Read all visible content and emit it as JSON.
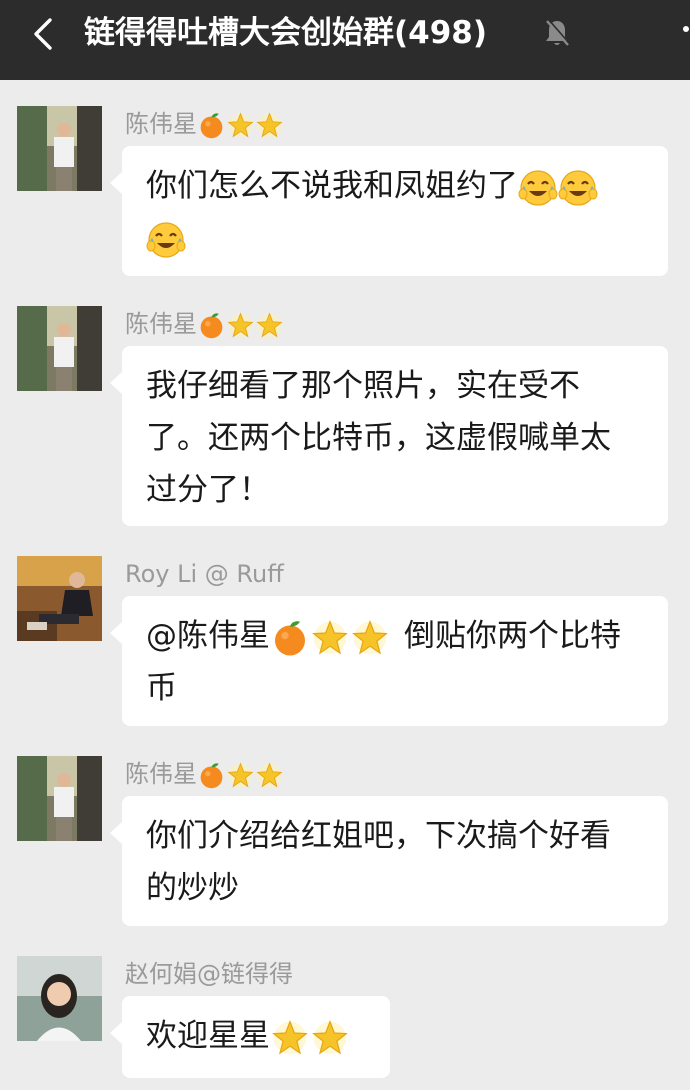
{
  "header": {
    "title": "链得得吐槽大会创始群(498)",
    "back_icon": "chevron-left-icon",
    "mute_icon": "bell-muted-icon",
    "more_icon": "more-icon"
  },
  "colors": {
    "header_bg": "#2c2c2c",
    "chat_bg": "#ececec",
    "bubble_bg": "#ffffff",
    "sender_name": "#9a9a9a"
  },
  "messages": [
    {
      "sender": "陈伟星",
      "sender_emojis": [
        "tangerine-emoji",
        "star-emoji",
        "star-emoji"
      ],
      "lines": [
        "你们怎么不说我和凤姐约了",
        ""
      ],
      "trailing_emojis": [
        "laughing-crying-emoji",
        "laughing-crying-emoji",
        "laughing-crying-emoji"
      ]
    },
    {
      "sender": "陈伟星",
      "sender_emojis": [
        "tangerine-emoji",
        "star-emoji",
        "star-emoji"
      ],
      "lines": [
        "我仔细看了那个照片，实在受不",
        "了。还两个比特币，这虚假喊单太",
        "过分了！"
      ]
    },
    {
      "sender": "Roy Li @ Ruff",
      "mention": "@陈伟星",
      "mention_emojis": [
        "tangerine-emoji",
        "star-emoji",
        "star-emoji"
      ],
      "lines": [
        "倒贴你两个比特",
        "币"
      ]
    },
    {
      "sender": "陈伟星",
      "sender_emojis": [
        "tangerine-emoji",
        "star-emoji",
        "star-emoji"
      ],
      "lines": [
        "你们介绍给红姐吧，下次搞个好看",
        "的炒炒"
      ]
    },
    {
      "sender": "赵何娟@链得得",
      "lines": [
        "欢迎星星"
      ],
      "trailing_emojis": [
        "star-emoji",
        "star-emoji"
      ]
    }
  ]
}
